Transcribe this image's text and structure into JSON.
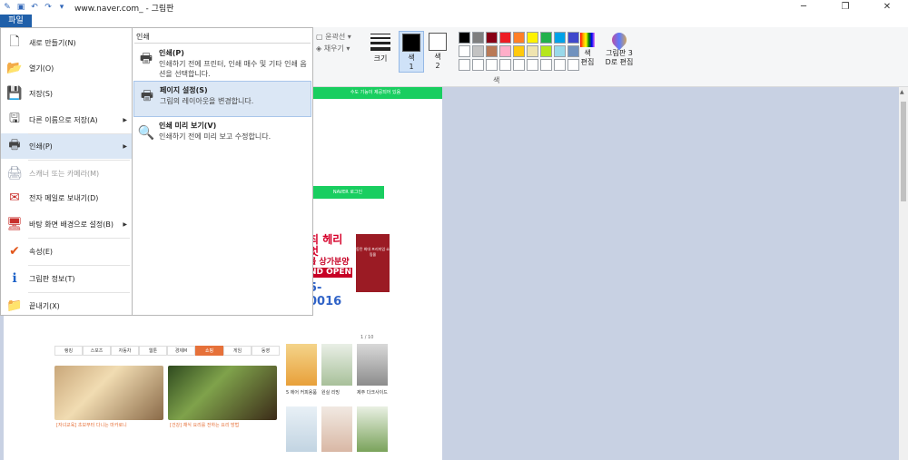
{
  "title_bar": {
    "title": "www.naver.com_ - 그림판",
    "quick_access": [
      "save-icon",
      "undo-icon",
      "redo-icon",
      "customize-icon"
    ],
    "window_buttons": [
      "minimize-icon",
      "restore-icon",
      "close-icon"
    ]
  },
  "tabs": {
    "file": "파일"
  },
  "ribbon": {
    "outline_label": "윤곽선",
    "fill_label": "채우기",
    "size_label": "크기",
    "color1_label": "색\n1",
    "color2_label": "색\n2",
    "color1_value": "#000000",
    "color2_value": "#ffffff",
    "palette": [
      "#000000",
      "#7f7f7f",
      "#880015",
      "#ed1c24",
      "#ff7f27",
      "#fff200",
      "#22b14c",
      "#00a2e8",
      "#3f48cc",
      "#ffffff",
      "#c3c3c3",
      "#b97a57",
      "#ffaec9",
      "#ffc90e",
      "#efe4b0",
      "#b5e61d",
      "#99d9ea",
      "#7092be",
      "#ffffff",
      "#ffffff",
      "#ffffff",
      "#ffffff",
      "#ffffff",
      "#ffffff",
      "#ffffff",
      "#ffffff",
      "#ffffff"
    ],
    "edit_colors_label": "색\n편집",
    "paint3d_label": "그림판 3\nD로 편집",
    "colors_group_label": "색"
  },
  "file_menu": {
    "items": [
      {
        "name": "menu-item-new",
        "label": "새로 만들기(N)",
        "icon": "new-file-icon",
        "disabled": false,
        "submenu": false
      },
      {
        "name": "menu-item-open",
        "label": "열기(O)",
        "icon": "open-folder-icon",
        "disabled": false,
        "submenu": false
      },
      {
        "name": "menu-item-save",
        "label": "저장(S)",
        "icon": "save-disk-icon",
        "disabled": false,
        "submenu": false
      },
      {
        "name": "menu-item-save-as",
        "label": "다른 이름으로 저장(A)",
        "icon": "save-as-icon",
        "disabled": false,
        "submenu": true
      },
      {
        "name": "menu-item-print",
        "label": "인쇄(P)",
        "icon": "printer-icon",
        "disabled": false,
        "submenu": true,
        "active": true
      },
      {
        "name": "menu-item-scanner",
        "label": "스캐너 또는 카메라(M)",
        "icon": "scanner-icon",
        "disabled": true,
        "submenu": false
      },
      {
        "name": "menu-item-email",
        "label": "전자 메일로 보내기(D)",
        "icon": "email-icon",
        "disabled": false,
        "submenu": false
      },
      {
        "name": "menu-item-desktop-bg",
        "label": "바탕 화면 배경으로 설정(B)",
        "icon": "desktop-background-icon",
        "disabled": false,
        "submenu": true
      },
      {
        "name": "menu-item-properties",
        "label": "속성(E)",
        "icon": "checkmark-icon",
        "disabled": false,
        "submenu": false
      },
      {
        "name": "menu-item-about",
        "label": "그림판 정보(T)",
        "icon": "info-icon",
        "disabled": false,
        "submenu": false
      },
      {
        "name": "menu-item-exit",
        "label": "끝내기(X)",
        "icon": "exit-icon",
        "disabled": false,
        "submenu": false
      }
    ]
  },
  "print_submenu": {
    "header": "인쇄",
    "items": [
      {
        "name": "submenu-print",
        "title": "인쇄(P)",
        "desc": "인쇄하기 전에 프린터, 인쇄 매수 및 기타 인쇄 옵션을 선택합니다.",
        "icon": "printer-icon"
      },
      {
        "name": "submenu-page-setup",
        "title": "페이지 설정(S)",
        "desc": "그림의 레이아웃을 변경합니다.",
        "icon": "page-setup-icon",
        "active": true
      },
      {
        "name": "submenu-print-preview",
        "title": "인쇄 미리 보기(V)",
        "desc": "인쇄하기 전에 미리 보고 수정합니다.",
        "icon": "print-preview-icon"
      }
    ]
  },
  "canvas_content": {
    "banner": "수도 기능이 제공되어 있음",
    "login_button": "NAVER 로그인",
    "ad_line1": "최 헤리엇",
    "ad_line2": "롤 상가분양",
    "ad_line3": "ND OPEN",
    "ad_phone": "5-0016",
    "side_ad": "동탄 최대 프리미엄 쇼핑몰",
    "tabs": [
      "랭킹",
      "스포츠",
      "자동차",
      "웹툰",
      "경제M",
      "쇼핑",
      "게임",
      "동영"
    ],
    "active_tab": 5,
    "page_indicator": "1 / 10",
    "photo1_caption": "[자녀교육] 초보부터 다니는 마카로니",
    "photo2_caption": "[건강] 채식 요리를 전하는 요리 방법",
    "thumb_captions": [
      "5 에어 커피용품",
      "원실 리빙",
      "제주 다크사이드"
    ]
  }
}
